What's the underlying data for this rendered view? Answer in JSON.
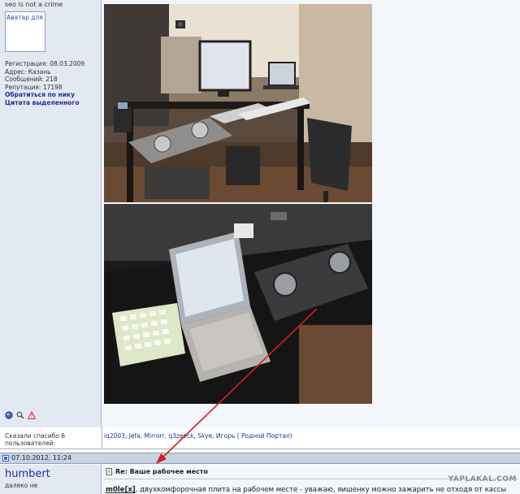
{
  "post1": {
    "user_title": "seo is not a crime",
    "avatar_alt": "Аватар для п",
    "info": {
      "registration": "Регистрация: 08.03.2009",
      "address": "Адрес: Казань",
      "messages": "Сообщений: 218",
      "reputation": "Репутация: 17198",
      "address_by_nick": "Обратиться по нику",
      "quote_selected": "Цитата выделенного"
    },
    "action_icons": [
      "online-status-icon",
      "search-icon",
      "report-icon"
    ]
  },
  "thanks": {
    "label": "Сказали спасибо 6 пользователей:",
    "list": "iq2003, Jefa, Mirrorr, q3zeeck, Skye, Игорь ( Родной Портал)"
  },
  "post2": {
    "date": "07.10.2012, 11:24",
    "username": "humbert",
    "status": "далеко не",
    "subject": "Re: Ваше рабочее место",
    "author_nick": "m0le[x]",
    "text": ", двухкомфорочная плита на рабочем месте - уважаю, яишенку можно зажарить не отходя от кассы"
  },
  "watermark": "YAPLAKAL.COM",
  "colors": {
    "link": "#1b3494",
    "sidebar_bg": "#e3e9f2",
    "header_bg": "#c7d2e3",
    "arrow": "#d21f1f"
  }
}
